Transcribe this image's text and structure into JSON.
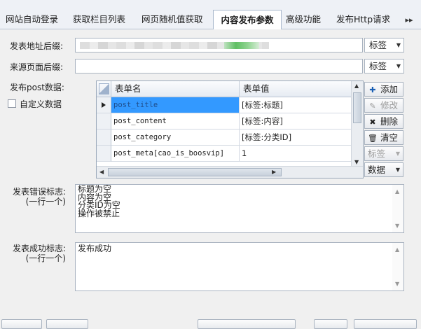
{
  "tabs": [
    {
      "label": "网站自动登录"
    },
    {
      "label": "获取栏目列表"
    },
    {
      "label": "网页随机值获取"
    },
    {
      "label": "内容发布参数"
    },
    {
      "label": "高级功能"
    },
    {
      "label": "发布Http请求"
    }
  ],
  "tab_scroll": "▸▸",
  "form": {
    "publish_url_label": "发表地址后缀:",
    "publish_url_tag": "标签",
    "source_page_label": "来源页面后缀:",
    "source_page_tag": "标签",
    "post_data_label": "发布post数据:",
    "custom_data_label": "自定义数据"
  },
  "grid": {
    "columns": [
      "表单名",
      "表单值"
    ],
    "rows": [
      {
        "name": "post_title",
        "value": "[标签:标题]"
      },
      {
        "name": "post_content",
        "value": "[标签:内容]"
      },
      {
        "name": "post_category",
        "value": "[标签:分类ID]"
      },
      {
        "name": "post_meta[cao_is_boosvip]",
        "value": "1"
      }
    ]
  },
  "side_buttons": {
    "add": "添加",
    "edit": "修改",
    "delete": "删除",
    "clear": "清空",
    "tag": "标签",
    "data": "数据"
  },
  "error_flag": {
    "label": "发表错误标志:",
    "hint": "(一行一个)",
    "lines": "标题为空\n内容为空\n分类ID为空\n操作被禁止"
  },
  "success_flag": {
    "label": "发表成功标志:",
    "hint": "(一行一个)",
    "lines": "发布成功"
  }
}
